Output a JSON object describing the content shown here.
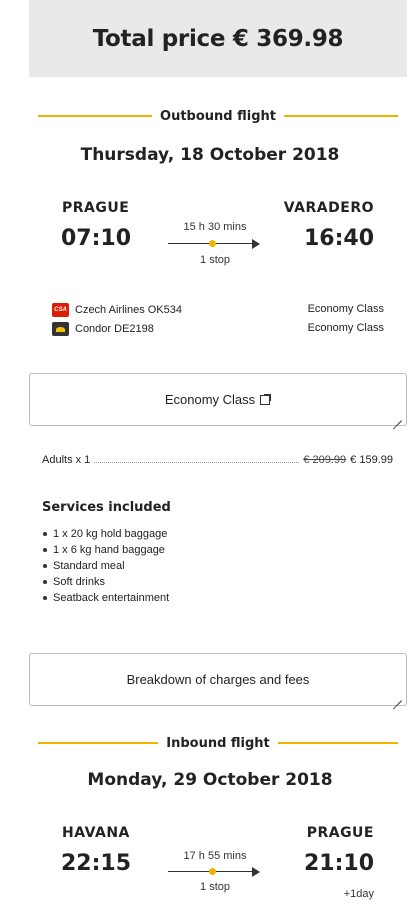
{
  "total": {
    "label": "Total price € 369.98"
  },
  "outbound": {
    "heading": "Outbound flight",
    "date": "Thursday, 18 October 2018",
    "origin_city": "PRAGUE",
    "origin_time": "07:10",
    "destination_city": "VARADERO",
    "destination_time": "16:40",
    "duration": "15 h 30 mins",
    "stops": "1 stop",
    "segments": [
      {
        "airline": "Czech Airlines OK534",
        "cabin": "Economy Class",
        "logo": "csa-logo"
      },
      {
        "airline": "Condor DE2198",
        "cabin": "Economy Class",
        "logo": "condor-logo"
      }
    ],
    "class_select": "Economy Class",
    "fare": {
      "label": "Adults x 1",
      "old_price": "€ 209.99",
      "new_price": "€ 159.99"
    },
    "services_title": "Services included",
    "services": [
      "1 x 20 kg hold baggage",
      "1 x 6 kg hand baggage",
      "Standard meal",
      "Soft drinks",
      "Seatback entertainment"
    ],
    "breakdown_label": "Breakdown of charges and fees"
  },
  "inbound": {
    "heading": "Inbound flight",
    "date": "Monday, 29 October 2018",
    "origin_city": "HAVANA",
    "origin_time": "22:15",
    "destination_city": "PRAGUE",
    "destination_time": "21:10",
    "plus_day": "+1day",
    "duration": "17 h 55 mins",
    "stops": "1 stop"
  },
  "colors": {
    "accent": "#f0b400",
    "total_bg": "#e9e9e7"
  }
}
